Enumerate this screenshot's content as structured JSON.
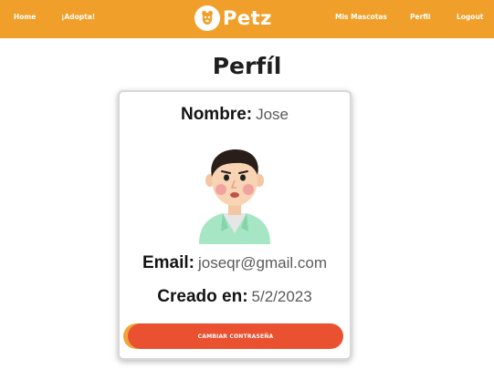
{
  "nav": {
    "home": "Home",
    "adopt": "¡Adopta!",
    "my_pets": "Mis Mascotas",
    "profile": "Perfil",
    "logout": "Logout"
  },
  "brand": {
    "name": "Petz",
    "logo_icon": "dog-head-icon",
    "nav_color": "#f0a02a"
  },
  "page": {
    "title": "Perfíl"
  },
  "profile": {
    "name_label": "Nombre:",
    "name_value": "Jose",
    "avatar_icon": "man-avatar-icon",
    "email_label": "Email:",
    "email_value": "joseqr@gmail.com",
    "created_label": "Creado en:",
    "created_value": "5/2/2023"
  },
  "actions": {
    "change_password": "CAMBIAR CONTRASEÑA",
    "button_color": "#ea5130"
  }
}
